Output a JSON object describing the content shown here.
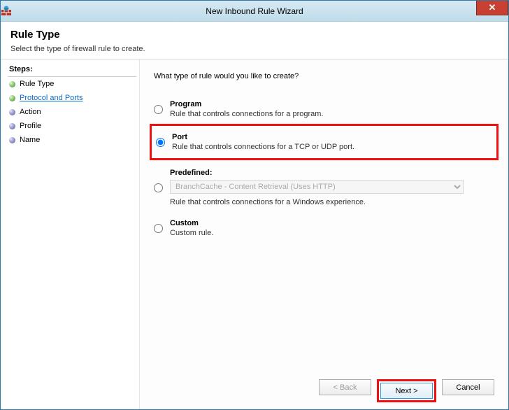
{
  "titlebar": {
    "title": "New Inbound Rule Wizard",
    "icon_name": "firewall-icon"
  },
  "header": {
    "title": "Rule Type",
    "subtitle": "Select the type of firewall rule to create."
  },
  "sidebar": {
    "heading": "Steps:",
    "items": [
      {
        "label": "Rule Type",
        "state": "done"
      },
      {
        "label": "Protocol and Ports",
        "state": "active"
      },
      {
        "label": "Action",
        "state": "future"
      },
      {
        "label": "Profile",
        "state": "future"
      },
      {
        "label": "Name",
        "state": "future"
      }
    ]
  },
  "content": {
    "prompt": "What type of rule would you like to create?",
    "options": [
      {
        "key": "program",
        "title": "Program",
        "desc": "Rule that controls connections for a program.",
        "selected": false,
        "highlighted": false
      },
      {
        "key": "port",
        "title": "Port",
        "desc": "Rule that controls connections for a TCP or UDP port.",
        "selected": true,
        "highlighted": true
      },
      {
        "key": "predefined",
        "title": "Predefined:",
        "desc": "Rule that controls connections for a Windows experience.",
        "selected": false,
        "highlighted": false,
        "dropdown": "BranchCache - Content Retrieval (Uses HTTP)"
      },
      {
        "key": "custom",
        "title": "Custom",
        "desc": "Custom rule.",
        "selected": false,
        "highlighted": false
      }
    ]
  },
  "footer": {
    "back": "< Back",
    "next": "Next >",
    "cancel": "Cancel",
    "next_highlighted": true
  }
}
